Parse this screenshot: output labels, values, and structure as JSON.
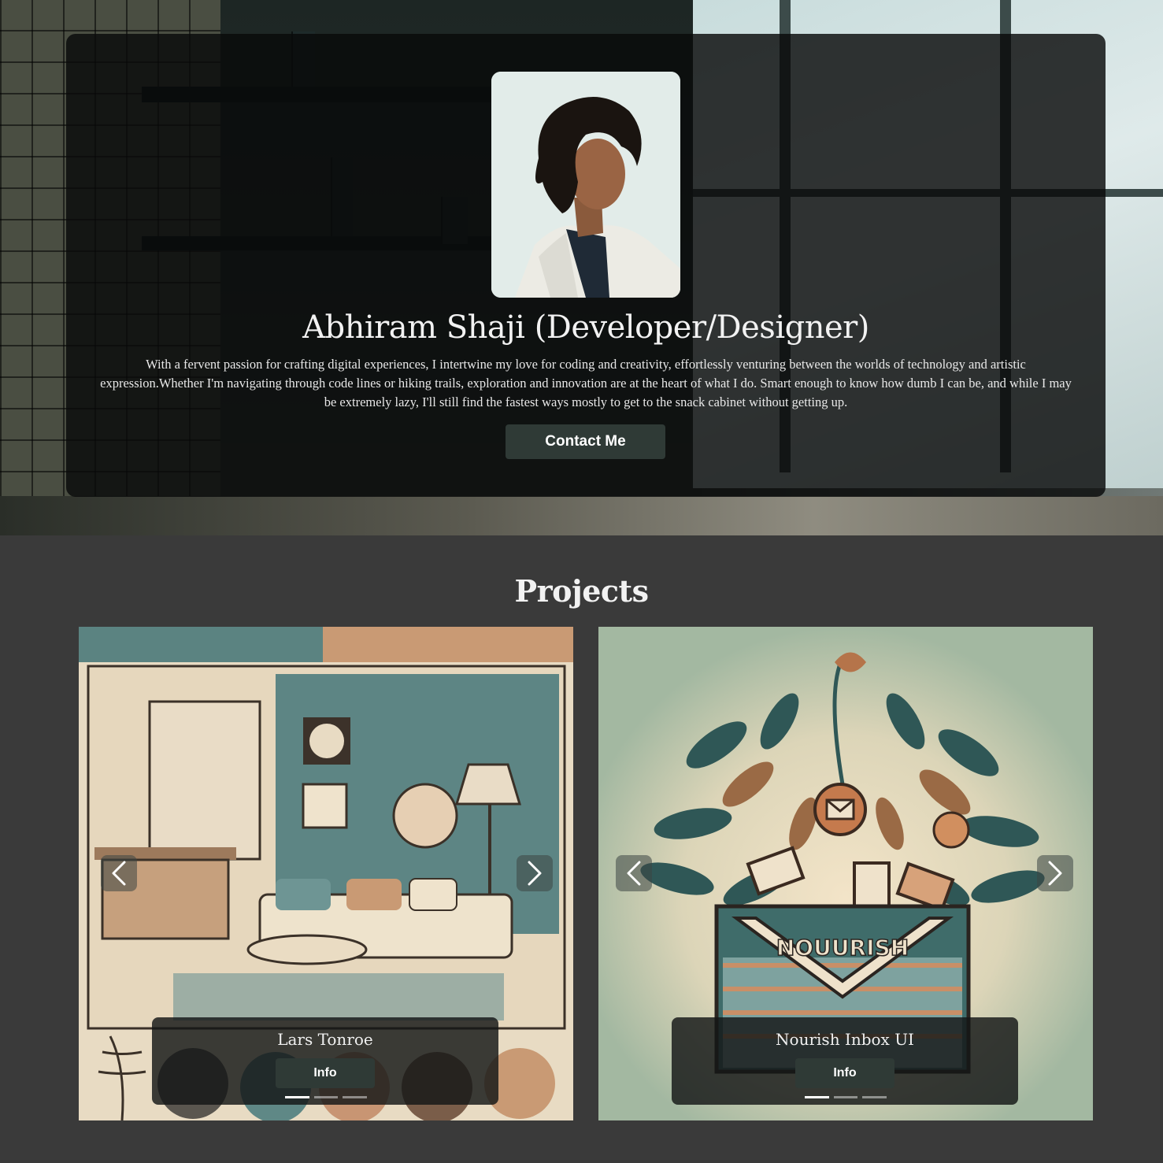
{
  "hero": {
    "name": "Abhiram Shaji (Developer/Designer)",
    "bio": "With a fervent passion for crafting digital experiences, I intertwine my love for coding and creativity, effortlessly venturing between the worlds of technology and artistic expression.Whether I'm navigating through code lines or hiking trails, exploration and innovation are at the heart of what I do. Smart enough to know how dumb I can be, and while I may be extremely lazy, I'll still find the fastest ways mostly to get to the snack cabinet without getting up.",
    "contact_label": "Contact Me"
  },
  "projects": {
    "title": "Projects",
    "cards": [
      {
        "title": "Lars Tonroe",
        "info_label": "Info",
        "slides": 3,
        "active_slide": 1
      },
      {
        "title": "Nourish Inbox UI",
        "info_label": "Info",
        "slides": 3,
        "active_slide": 1,
        "art_text": "NOUURISH"
      }
    ]
  },
  "colors": {
    "page_bg": "#3a3a3a",
    "button_bg": "#2f3a36",
    "card_overlay": "rgba(8,10,10,0.82)"
  }
}
